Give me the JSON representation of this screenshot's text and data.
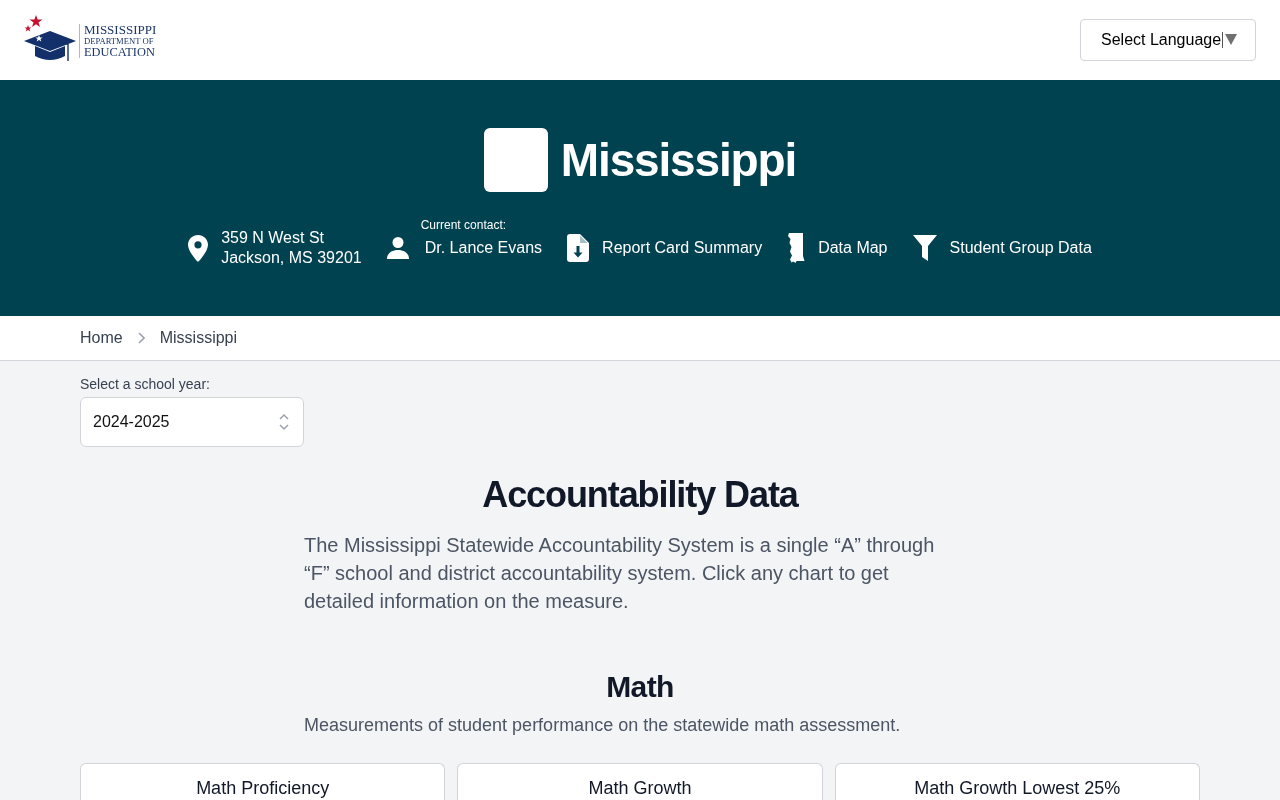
{
  "header": {
    "logo": {
      "lines": [
        "MISSISSIPPI",
        "DEPARTMENT OF",
        "EDUCATION"
      ]
    },
    "language_select": {
      "label": "Select Language"
    }
  },
  "banner": {
    "title": "Mississippi",
    "info": [
      {
        "kind": "address",
        "lines": [
          "359 N West St",
          "Jackson, MS 39201"
        ]
      },
      {
        "kind": "contact",
        "caption": "Current contact:",
        "label": "Dr. Lance Evans"
      },
      {
        "kind": "report",
        "label": "Report Card Summary"
      },
      {
        "kind": "map",
        "label": "Data Map"
      },
      {
        "kind": "filter",
        "label": "Student Group Data"
      }
    ]
  },
  "breadcrumb": [
    {
      "label": "Home"
    },
    {
      "label": "Mississippi"
    }
  ],
  "school_year": {
    "label": "Select a school year:",
    "value": "2024-2025"
  },
  "accountability": {
    "title": "Accountability Data",
    "description": "The Mississippi Statewide Accountability System is a single “A” through “F” school and district accountability system. Click any chart to get detailed information on the measure."
  },
  "math": {
    "title": "Math",
    "description": "Measurements of student performance on the statewide math assessment.",
    "cards": [
      {
        "title": "Math Proficiency"
      },
      {
        "title": "Math Growth"
      },
      {
        "title": "Math Growth Lowest 25%"
      }
    ]
  }
}
